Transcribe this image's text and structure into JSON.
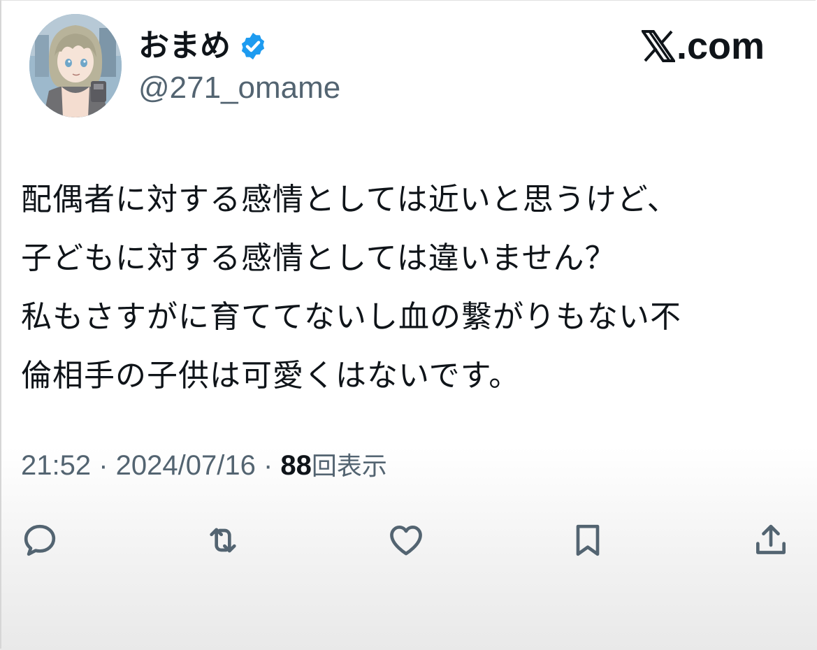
{
  "author": {
    "display_name": "おまめ",
    "handle": "@271_omame",
    "verified_icon": "verified-badge-icon",
    "avatar": "anime-girl-avatar"
  },
  "site": {
    "label": ".com",
    "logo_icon": "x-logo-icon"
  },
  "tweet": {
    "lines": [
      "配偶者に対する感情としては近いと思うけど、",
      "子どもに対する感情としては違いません？",
      "私もさすがに育ててないし血の繋がりもない不",
      "倫相手の子供は可愛くはないです。"
    ]
  },
  "meta": {
    "time": "21:52",
    "separator": " · ",
    "date": "2024/07/16",
    "views_count": "88",
    "views_label": "回表示"
  },
  "actions": {
    "reply_icon": "reply-icon",
    "retweet_icon": "retweet-icon",
    "like_icon": "heart-icon",
    "bookmark_icon": "bookmark-icon",
    "share_icon": "share-icon"
  },
  "colors": {
    "text": "#0f1419",
    "secondary": "#536471",
    "verified": "#1d9bf0"
  }
}
